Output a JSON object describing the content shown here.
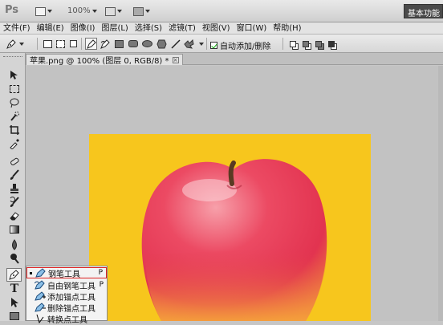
{
  "appbar": {
    "logo": "Ps",
    "zoom": "100%",
    "workspace": "基本功能"
  },
  "menu": [
    "文件(F)",
    "编辑(E)",
    "图像(I)",
    "图层(L)",
    "选择(S)",
    "滤镜(T)",
    "视图(V)",
    "窗口(W)",
    "帮助(H)"
  ],
  "options": {
    "auto_add_delete": "自动添加/删除",
    "auto_add_checked": true
  },
  "document": {
    "tab_title": "苹果.png @ 100% (图层 0, RGB/8) *",
    "tab_close": "×"
  },
  "flyout": {
    "items": [
      {
        "label": "钢笔工具",
        "shortcut": "P",
        "selected": true,
        "icon": "pen-icon"
      },
      {
        "label": "自由钢笔工具",
        "shortcut": "P",
        "selected": false,
        "icon": "freeform-pen-icon"
      },
      {
        "label": "添加锚点工具",
        "shortcut": "",
        "selected": false,
        "icon": "add-anchor-icon"
      },
      {
        "label": "删除锚点工具",
        "shortcut": "",
        "selected": false,
        "icon": "delete-anchor-icon"
      },
      {
        "label": "转换点工具",
        "shortcut": "",
        "selected": false,
        "icon": "convert-point-icon"
      }
    ]
  },
  "colors": {
    "image_background": "#f7c61d",
    "selection_outline": "#d22222"
  }
}
